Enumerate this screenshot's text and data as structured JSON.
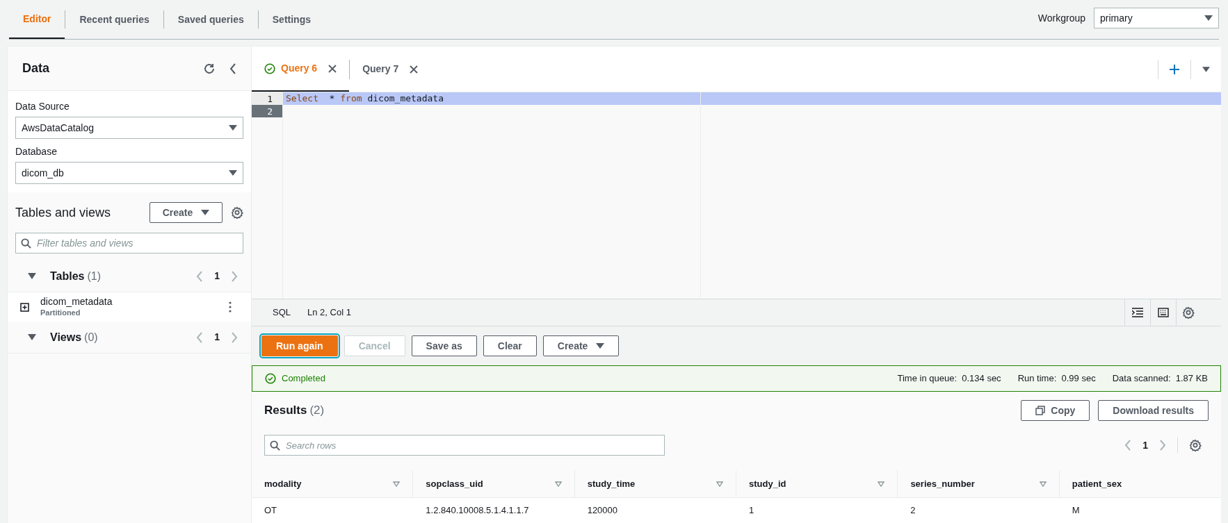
{
  "top_tabs": [
    {
      "label": "Editor",
      "selected": true
    },
    {
      "label": "Recent queries",
      "selected": false
    },
    {
      "label": "Saved queries",
      "selected": false
    },
    {
      "label": "Settings",
      "selected": false
    }
  ],
  "workgroup": {
    "label": "Workgroup",
    "value": "primary"
  },
  "data_panel": {
    "title": "Data",
    "data_source": {
      "label": "Data Source",
      "value": "AwsDataCatalog"
    },
    "database": {
      "label": "Database",
      "value": "dicom_db"
    },
    "tables_and_views": {
      "title": "Tables and views",
      "create_button": "Create",
      "filter_placeholder": "Filter tables and views"
    },
    "sections": [
      {
        "title": "Tables",
        "count": "(1)",
        "expanded": true,
        "page": "1",
        "items": [
          {
            "name": "dicom_metadata",
            "note": "Partitioned"
          }
        ]
      },
      {
        "title": "Views",
        "count": "(0)",
        "expanded": true,
        "page": "1"
      }
    ]
  },
  "query_tabs": [
    {
      "label": "Query 6",
      "selected": true,
      "completed": true
    },
    {
      "label": "Query 7",
      "selected": false,
      "completed": false
    }
  ],
  "editor": {
    "lines": [
      {
        "number": "1",
        "selected": true,
        "current": false,
        "tokens": [
          {
            "kind": "keyword",
            "text": "Select"
          },
          {
            "kind": "plain",
            "text": "  * "
          },
          {
            "kind": "keyword",
            "text": "from"
          },
          {
            "kind": "plain",
            "text": " dicom_metadata"
          }
        ]
      },
      {
        "number": "2",
        "selected": false,
        "current": true
      }
    ]
  },
  "status_bar": {
    "language": "SQL",
    "position": "Ln 2, Col 1"
  },
  "actions": [
    {
      "label": "Run again",
      "kind": "primary",
      "disabled": false
    },
    {
      "label": "Cancel",
      "kind": "normal",
      "disabled": true
    },
    {
      "label": "Save as",
      "kind": "normal",
      "disabled": false
    },
    {
      "label": "Clear",
      "kind": "normal",
      "disabled": false
    },
    {
      "label": "Create",
      "kind": "dropdown",
      "disabled": false
    }
  ],
  "run_status": {
    "status": "Completed",
    "stats": [
      {
        "label": "Time in queue:",
        "value": "0.134 sec"
      },
      {
        "label": "Run time:",
        "value": "0.99 sec"
      },
      {
        "label": "Data scanned:",
        "value": "1.87 KB"
      }
    ]
  },
  "results": {
    "title": "Results",
    "count": "(2)",
    "copy_button": "Copy",
    "download_button": "Download results",
    "search_placeholder": "Search rows",
    "page": "1",
    "columns": [
      "modality",
      "sopclass_uid",
      "study_time",
      "study_id",
      "series_number",
      "patient_sex"
    ],
    "rows": [
      [
        "OT",
        "1.2.840.10008.5.1.4.1.1.7",
        "120000",
        "1",
        "2",
        "M"
      ]
    ]
  }
}
